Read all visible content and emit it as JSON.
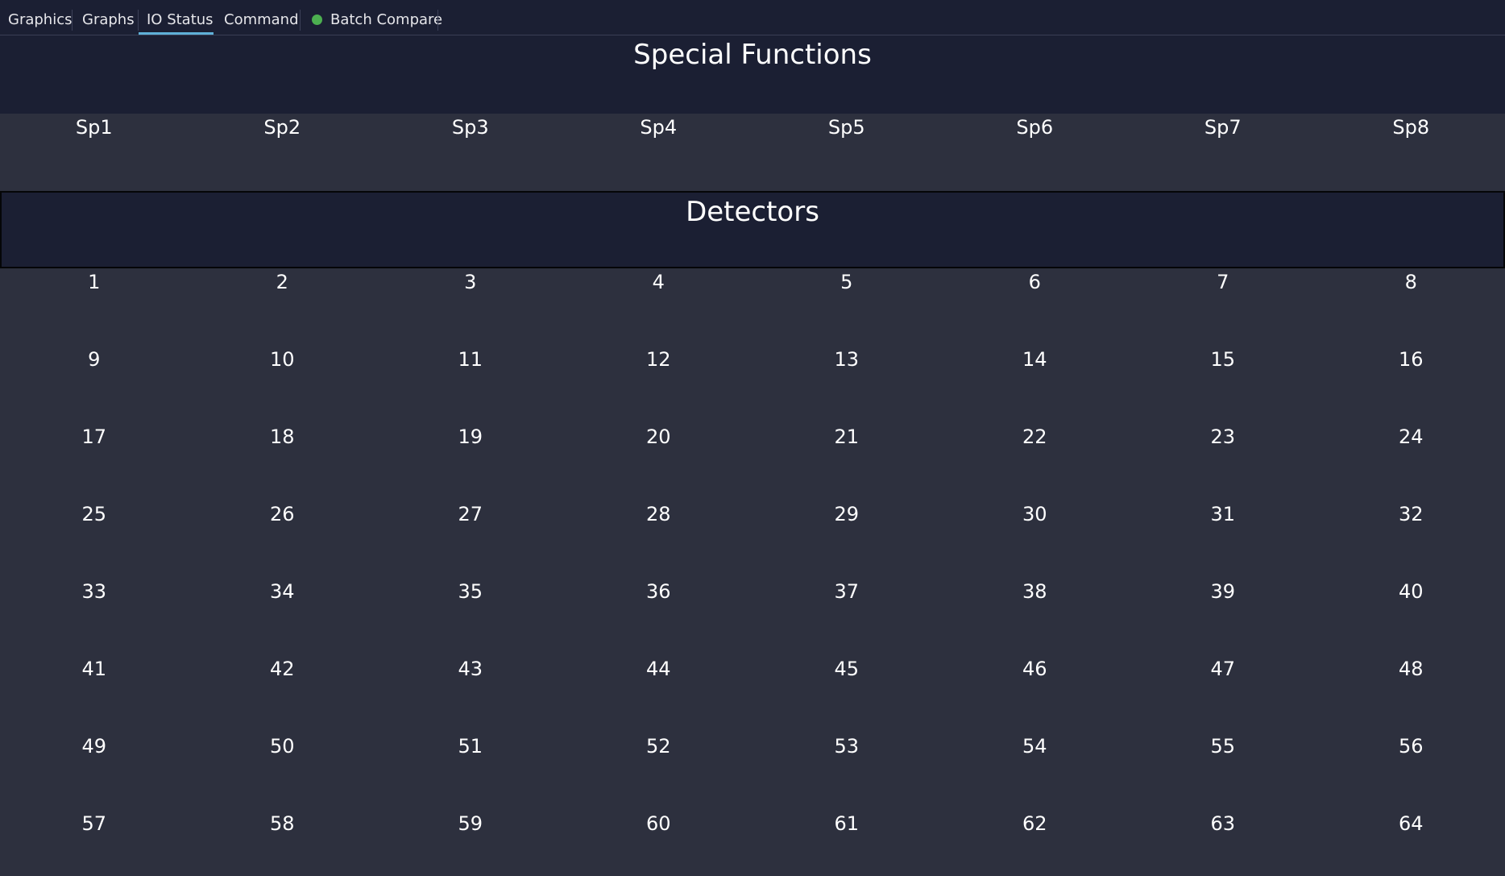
{
  "tabs": [
    {
      "label": "Graphics",
      "active": false
    },
    {
      "label": "Graphs",
      "active": false
    },
    {
      "label": "IO Status",
      "active": true
    },
    {
      "label": "Command",
      "active": false
    },
    {
      "label": "Batch Compare",
      "active": false,
      "status_color": "#4caf50",
      "status_icon": "status-dot-icon"
    }
  ],
  "special_functions": {
    "title": "Special Functions",
    "items": [
      "Sp1",
      "Sp2",
      "Sp3",
      "Sp4",
      "Sp5",
      "Sp6",
      "Sp7",
      "Sp8"
    ]
  },
  "detectors": {
    "title": "Detectors",
    "items": [
      "1",
      "2",
      "3",
      "4",
      "5",
      "6",
      "7",
      "8",
      "9",
      "10",
      "11",
      "12",
      "13",
      "14",
      "15",
      "16",
      "17",
      "18",
      "19",
      "20",
      "21",
      "22",
      "23",
      "24",
      "25",
      "26",
      "27",
      "28",
      "29",
      "30",
      "31",
      "32",
      "33",
      "34",
      "35",
      "36",
      "37",
      "38",
      "39",
      "40",
      "41",
      "42",
      "43",
      "44",
      "45",
      "46",
      "47",
      "48",
      "49",
      "50",
      "51",
      "52",
      "53",
      "54",
      "55",
      "56",
      "57",
      "58",
      "59",
      "60",
      "61",
      "62",
      "63",
      "64"
    ]
  },
  "colors": {
    "header_bg": "#1b1f33",
    "body_bg": "#2d303e",
    "active_tab_underline": "#5fb0d8"
  }
}
